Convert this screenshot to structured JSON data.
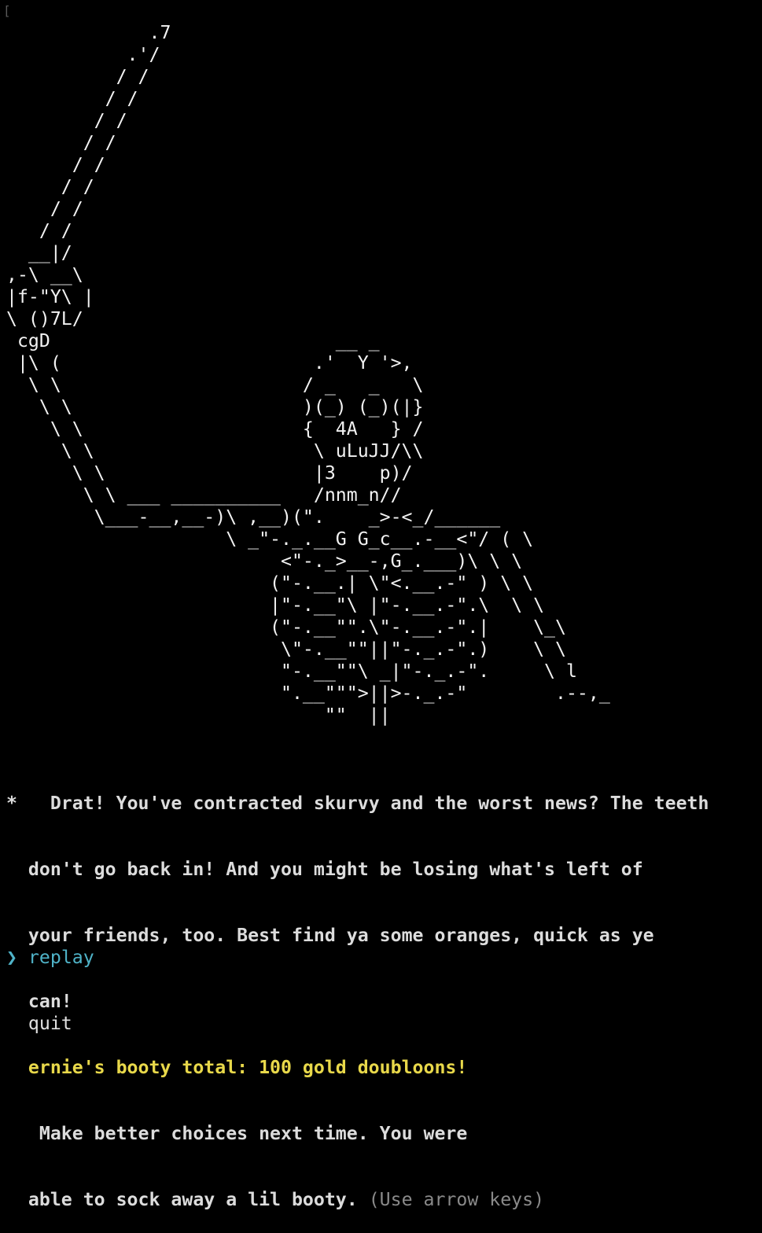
{
  "terminal": {
    "cursor_mark": "[",
    "ascii_art": [
      "             .7",
      "           .'/",
      "          / /",
      "         / /",
      "        / /",
      "       / /",
      "      / /",
      "     / /",
      "    / /",
      "   / /",
      "  __|/",
      ",-\\ __\\",
      "|f-\"Y\\ |",
      "\\ ()7L/",
      " cgD                          __ _",
      " |\\ (                       .'  Y '>,",
      "  \\ \\                      / _   _   \\",
      "   \\ \\                     )(_) (_)(|}",
      "    \\ \\                    {  4A   } /",
      "     \\ \\                    \\ uLuJJ/\\\\",
      "      \\ \\                   |3    p)/",
      "       \\ \\ ___ __________   /nnm_n//",
      "        \\___-__,__-)\\ ,__)(\".    _>-<_/______",
      "                    \\ _\"-._.__G G_c__.-__<\"/ ( \\",
      "                         <\"-._>__-,G_.___)\\ \\ \\",
      "                        (\"-.__.| \\\"<.__.-\" ) \\ \\",
      "                        |\"-.__\"\\ |\"-.__.-\".\\  \\ \\",
      "                        (\"-.__\"\".\\\"-.__.-\".|    \\_\\",
      "                         \\\"-.__\"\"||\"-._.-\".)    \\ \\",
      "                         \"-.__\"\"\\ _|\"-._.-\".     \\ l",
      "                         \".__\"\"\">||>-._.-\"        .--,_",
      "                             \"\"  ||"
    ],
    "message": {
      "bullet": "*",
      "lines": [
        "   Drat! You've contracted skurvy and the worst news? The teeth",
        "don't go back in! And you might be losing what's left of",
        "your friends, too. Best find ya some oranges, quick as ye",
        "can!"
      ],
      "booty_line": "ernie's booty total: 100 gold doubloons!",
      "advice_lines": [
        " Make better choices next time. You were",
        "able to sock away a lil booty."
      ],
      "hint": "(Use arrow keys)"
    },
    "menu": {
      "pointer": "❯",
      "options": [
        {
          "label": "replay",
          "selected": true
        },
        {
          "label": "quit",
          "selected": false
        }
      ]
    }
  },
  "colors": {
    "background": "#000000",
    "text": "#e8e8e8",
    "gold": "#e8d84a",
    "accent": "#4fb3c8",
    "hint": "#8a8a8a"
  }
}
